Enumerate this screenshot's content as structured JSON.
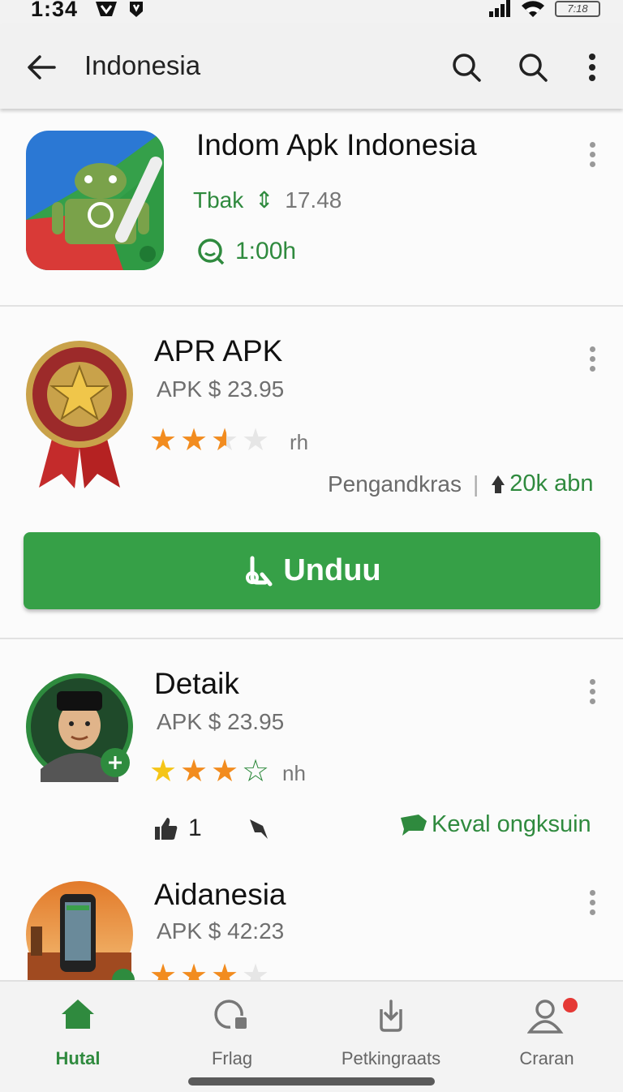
{
  "status_bar": {
    "time": "1:34",
    "battery": "7:18"
  },
  "app_bar": {
    "title": "Indonesia"
  },
  "cards": [
    {
      "title": "Indom Apk Indonesia",
      "meta_label": "Tbak",
      "meta_value": "17.48",
      "duration": "1:00h"
    },
    {
      "title": "APR APK",
      "price": "APK $ 23.95",
      "rating": 2.5,
      "rating_suffix": "rh",
      "publisher": "Pengandkras",
      "downloads": "20k abn",
      "download_button": "Unduu"
    },
    {
      "title": "Detaik",
      "price": "APK $ 23.95",
      "rating": 3,
      "rating_suffix": "nh",
      "likes": "1",
      "feature": "Keval ongksuin"
    },
    {
      "title": "Aidanesia",
      "price": "APK $ 42:23",
      "rating": 3
    }
  ],
  "nav": {
    "items": [
      {
        "label": "Hutal",
        "icon": "home-icon",
        "active": true
      },
      {
        "label": "Frlag",
        "icon": "chat-icon",
        "active": false
      },
      {
        "label": "Petkingraats",
        "icon": "download-icon",
        "active": false
      },
      {
        "label": "Craran",
        "icon": "profile-icon",
        "active": false,
        "badge": true
      }
    ]
  },
  "colors": {
    "accent": "#36a047",
    "accent_text": "#2f8a3e",
    "star": "#f28c1f",
    "star_empty": "#e6e6e6",
    "badge": "#e53935"
  }
}
